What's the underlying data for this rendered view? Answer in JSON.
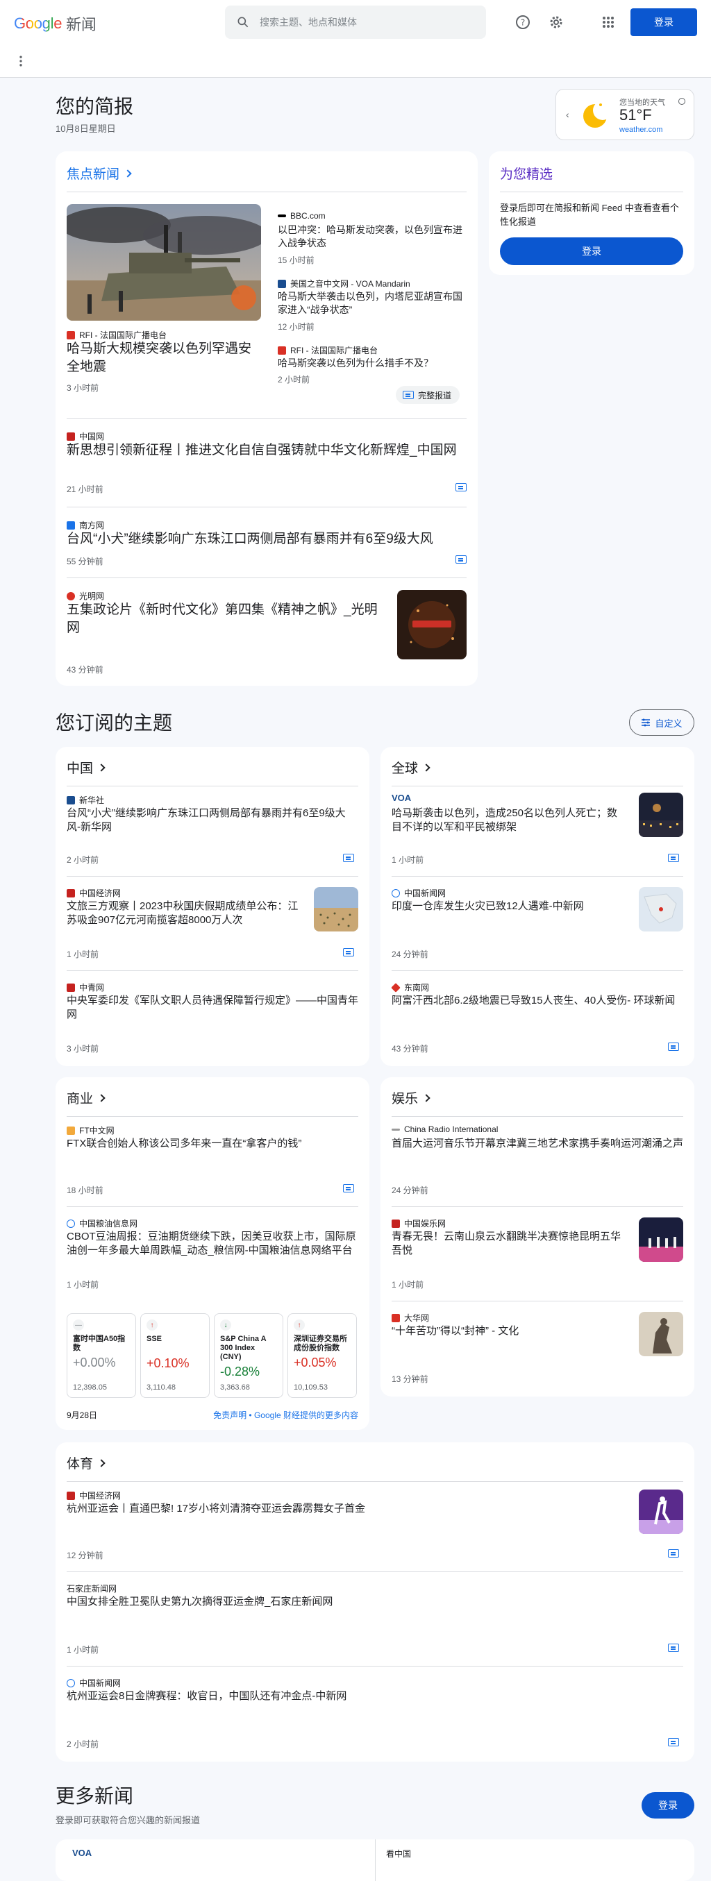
{
  "header": {
    "logo_google": "Google",
    "logo_news": "新闻",
    "search_placeholder": "搜索主题、地点和媒体",
    "login": "登录"
  },
  "briefing": {
    "title": "您的简报",
    "date": "10月8日星期日"
  },
  "weather": {
    "label": "您当地的天气",
    "temp": "51°F",
    "source": "weather.com"
  },
  "top_stories": {
    "title": "焦点新闻",
    "main": {
      "source": "RFI - 法国国际广播电台",
      "headline": "哈马斯大规模突袭以色列罕遇安全地震",
      "time": "3 小时前"
    },
    "side": [
      {
        "source": "BBC.com",
        "headline": "以巴冲突：哈马斯发动突袭，以色列宣布进入战争状态",
        "time": "15 小时前"
      },
      {
        "source": "美国之音中文网 - VOA Mandarin",
        "headline": "哈马斯大举袭击以色列，内塔尼亚胡宣布国家进入“战争状态”",
        "time": "12 小时前"
      },
      {
        "source": "RFI - 法国国际广播电台",
        "headline": "哈马斯突袭以色列为什么措手不及？",
        "time": "2 小时前"
      }
    ],
    "full_coverage": "完整报道",
    "more": [
      {
        "source": "中国网",
        "headline": "新思想引领新征程丨推进文化自信自强铸就中华文化新辉煌_中国网",
        "time": "21 小时前"
      },
      {
        "source": "南方网",
        "headline": "台风“小犬”继续影响广东珠江口两侧局部有暴雨并有6至9级大风",
        "time": "55 分钟前"
      },
      {
        "source": "光明网",
        "headline": "五集政论片《新时代文化》第四集《精神之帆》_光明网",
        "time": "43 分钟前"
      }
    ]
  },
  "for_you": {
    "title": "为您精选",
    "text": "登录后即可在简报和新闻 Feed 中查看查看个性化报道",
    "login": "登录"
  },
  "topics": {
    "title": "您订阅的主题",
    "customize": "自定义"
  },
  "china": {
    "title": "中国",
    "items": [
      {
        "source": "新华社",
        "headline": "台风“小犬”继续影响广东珠江口两侧局部有暴雨并有6至9级大风-新华网",
        "time": "2 小时前"
      },
      {
        "source": "中国经济网",
        "headline": "文旅三方观察丨2023中秋国庆假期成绩单公布：江苏吸金907亿元河南揽客超8000万人次",
        "time": "1 小时前"
      },
      {
        "source": "中青网",
        "headline": "中央军委印发《军队文职人员待遇保障暂行规定》——中国青年网",
        "time": "3 小时前"
      }
    ]
  },
  "world": {
    "title": "全球",
    "items": [
      {
        "source": "VOA",
        "headline": "哈马斯袭击以色列，造成250名以色列人死亡；数目不详的以军和平民被绑架",
        "time": "1 小时前"
      },
      {
        "source": "中国新闻网",
        "headline": "印度一仓库发生火灾已致12人遇难-中新网",
        "time": "24 分钟前"
      },
      {
        "source": "东南网",
        "headline": "阿富汗西北部6.2级地震已导致15人丧生、40人受伤- 环球新闻",
        "time": "43 分钟前"
      }
    ]
  },
  "business": {
    "title": "商业",
    "items": [
      {
        "source": "FT中文网",
        "headline": "FTX联合创始人称该公司多年来一直在“拿客户的钱”",
        "time": "18 小时前"
      },
      {
        "source": "中国粮油信息网",
        "headline": "CBOT豆油周报：豆油期货继续下跌，因美豆收获上市，国际原油创一年多最大单周跌幅_动态_粮信网-中国粮油信息网络平台",
        "time": "1 小时前"
      }
    ],
    "stocks": [
      {
        "name": "富时中国A50指数",
        "pct": "+0.00%",
        "value": "12,398.05",
        "dir": "flat"
      },
      {
        "name": "SSE",
        "pct": "+0.10%",
        "value": "3,110.48",
        "dir": "up"
      },
      {
        "name": "S&P China A 300 Index (CNY)",
        "pct": "-0.28%",
        "value": "3,363.68",
        "dir": "down"
      },
      {
        "name": "深圳证券交易所成份股价指数",
        "pct": "+0.05%",
        "value": "10,109.53",
        "dir": "up"
      }
    ],
    "date": "9月28日",
    "disclaimer": "免责声明 • Google 财经提供的更多内容"
  },
  "entertainment": {
    "title": "娱乐",
    "items": [
      {
        "source": "China Radio International",
        "headline": "首届大运河音乐节开幕京津冀三地艺术家携手奏响运河潮涌之声",
        "time": "24 分钟前"
      },
      {
        "source": "中国娱乐网",
        "headline": "青春无畏！云南山泉云水翻跳半决赛惊艳昆明五华吾悦",
        "time": "1 小时前"
      },
      {
        "source": "大华网",
        "headline": "“十年苦功”得以“封神” - 文化",
        "time": "13 分钟前"
      }
    ]
  },
  "sports": {
    "title": "体育",
    "items": [
      {
        "source": "中国经济网",
        "headline": "杭州亚运会丨直通巴黎! 17岁小将刘清漪夺亚运会霹雳舞女子首金",
        "time": "12 分钟前"
      },
      {
        "source": "石家庄新闻网",
        "headline": "中国女排全胜卫冕队史第九次摘得亚运金牌_石家庄新闻网",
        "time": "1 小时前"
      },
      {
        "source": "中国新闻网",
        "headline": "杭州亚运会8日金牌赛程：收官日，中国队还有冲金点-中新网",
        "time": "2 小时前"
      }
    ]
  },
  "more_news": {
    "title": "更多新闻",
    "subtitle": "登录即可获取符合您兴趣的新闻报道",
    "login": "登录",
    "left_source": "VOA",
    "right_source": "看中国"
  }
}
